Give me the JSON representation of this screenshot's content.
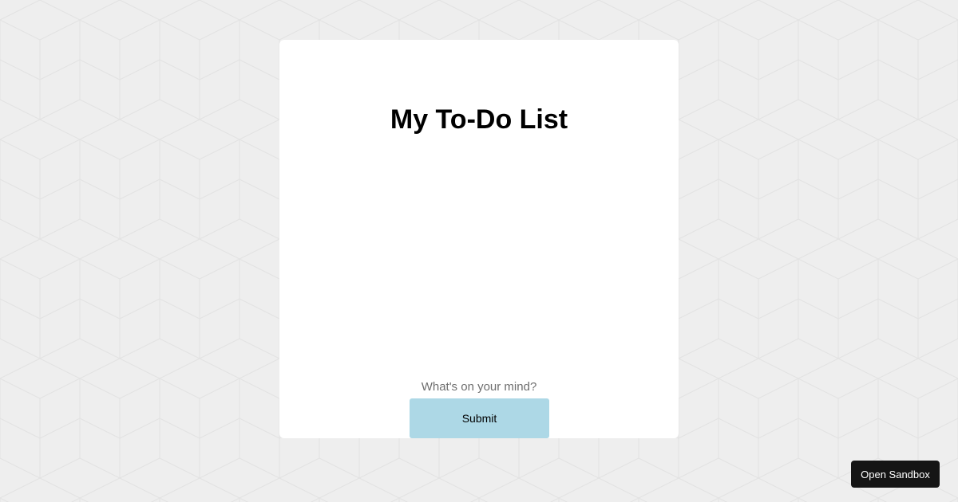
{
  "todo": {
    "title": "My To-Do List",
    "items": [],
    "input_placeholder": "What's on your mind?",
    "input_value": "",
    "submit_label": "Submit"
  },
  "sandbox": {
    "open_label": "Open Sandbox"
  },
  "colors": {
    "page_background": "#eeeeee",
    "card_background": "#ffffff",
    "submit_button": "#add8e6",
    "sandbox_button": "#151515"
  }
}
